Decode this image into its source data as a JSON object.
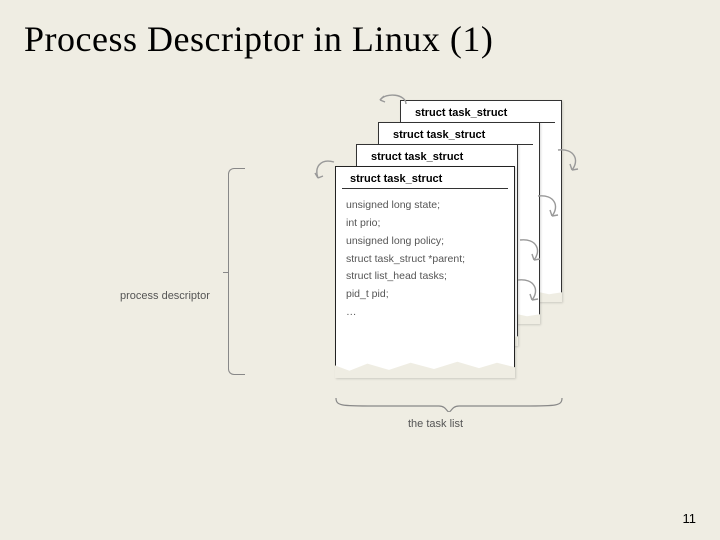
{
  "title": "Process Descriptor in Linux (1)",
  "page_number": "11",
  "diagram": {
    "struct_label_back3": "struct task_struct",
    "struct_label_back2": "struct task_struct",
    "struct_label_back1": "struct task_struct",
    "struct_label_front": "struct task_struct",
    "fields": [
      "unsigned long state;",
      "int prio;",
      "unsigned long policy;",
      "struct task_struct *parent;",
      "struct list_head tasks;",
      "pid_t pid;",
      "…"
    ],
    "left_label": "process descriptor",
    "bottom_label": "the task list"
  }
}
